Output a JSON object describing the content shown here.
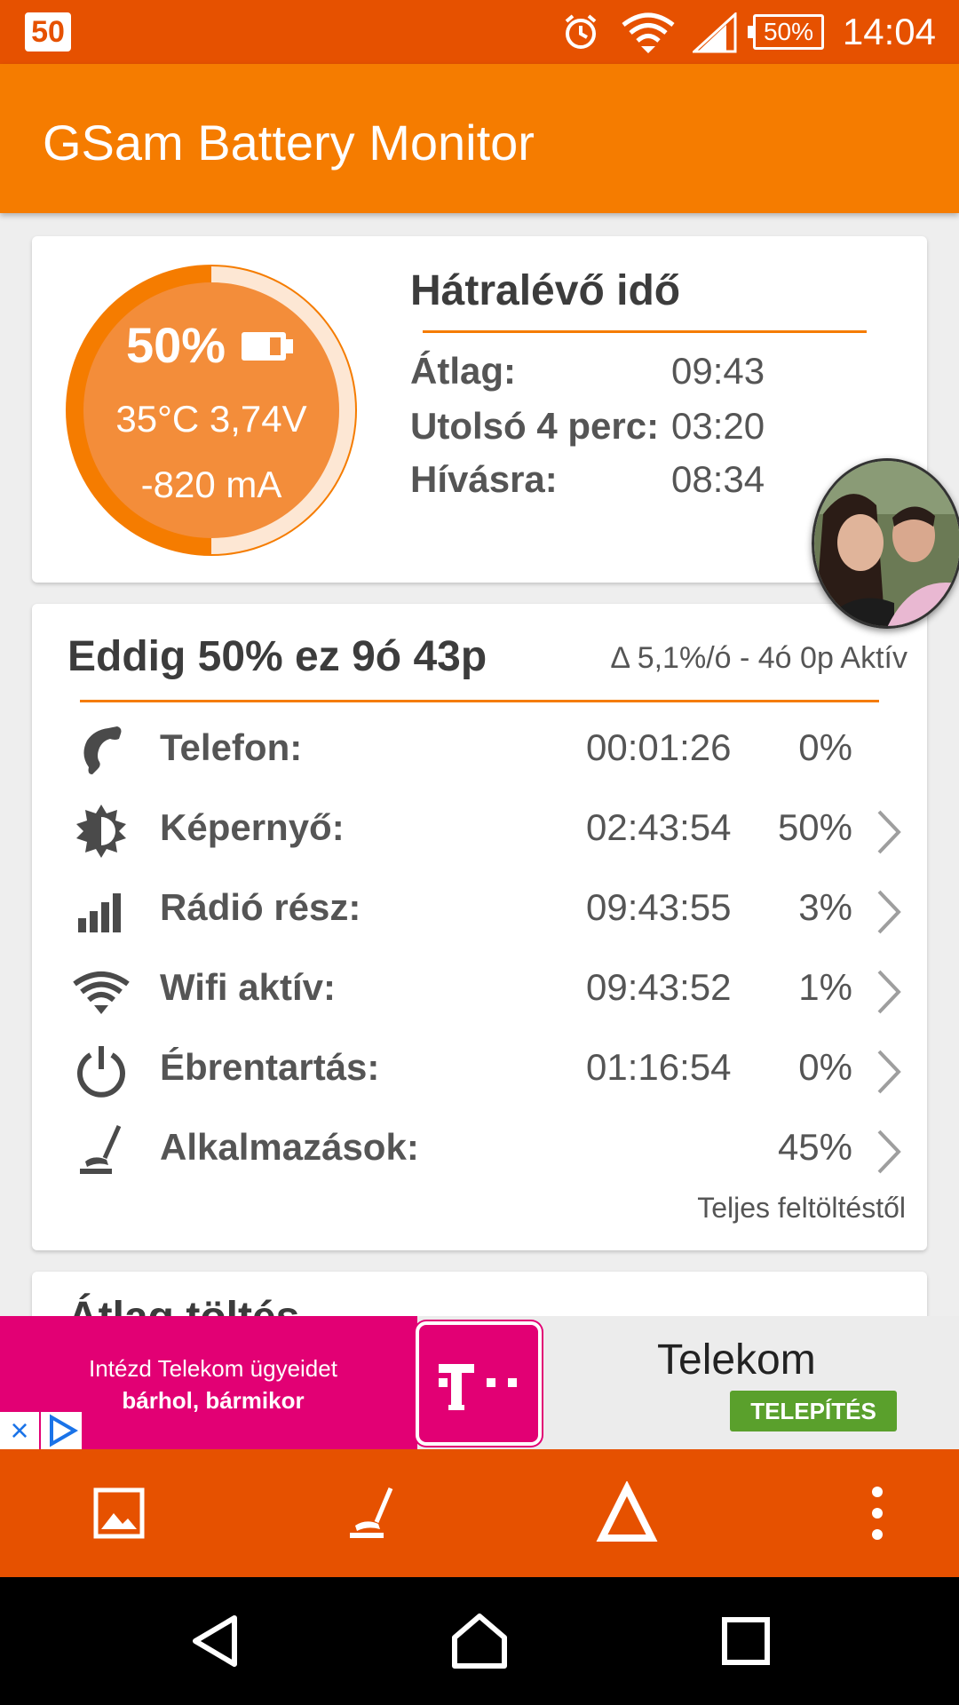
{
  "status_bar": {
    "badge": "50",
    "battery": "50%",
    "time": "14:04",
    "icons": [
      "alarm-icon",
      "wifi-icon",
      "signal-icon",
      "battery-icon"
    ]
  },
  "app": {
    "title": "GSam Battery Monitor",
    "accent": "#f57c00",
    "dark_accent": "#e65100"
  },
  "gauge": {
    "percent_label": "50%",
    "level": 0.5,
    "temperature": "35°C",
    "voltage": "3,74V",
    "temp_volt": "35°C  3,74V",
    "current": "-820 mA"
  },
  "remaining": {
    "title": "Hátralévő idő",
    "rows": [
      {
        "label": "Átlag:",
        "value": "09:43"
      },
      {
        "label": "Utolsó 4 perc:",
        "value": "03:20"
      },
      {
        "label": "Hívásra:",
        "value": "08:34"
      }
    ]
  },
  "usage": {
    "title": "Eddig 50% ez 9ó 43p",
    "rate": "Δ 5,1%/ó - 4ó 0p Aktív",
    "rows": [
      {
        "icon": "phone-icon",
        "label": "Telefon:",
        "time": "00:01:26",
        "pct": "0%",
        "chevron": false
      },
      {
        "icon": "screen-brightness-icon",
        "label": "Képernyő:",
        "time": "02:43:54",
        "pct": "50%",
        "chevron": true
      },
      {
        "icon": "signal-bars-icon",
        "label": "Rádió rész:",
        "time": "09:43:55",
        "pct": "3%",
        "chevron": true
      },
      {
        "icon": "wifi-icon",
        "label": "Wifi aktív:",
        "time": "09:43:52",
        "pct": "1%",
        "chevron": true
      },
      {
        "icon": "power-icon",
        "label": "Ébrentartás:",
        "time": "01:16:54",
        "pct": "0%",
        "chevron": true
      },
      {
        "icon": "apps-broom-icon",
        "label": "Alkalmazások:",
        "time": "",
        "pct": "45%",
        "chevron": true
      }
    ],
    "footer": "Teljes feltöltéstől"
  },
  "next_card": {
    "title": "Átlag töltés"
  },
  "ad": {
    "line1": "Intézd Telekom ügyeidet",
    "line2": "bárhol, bármikor",
    "brand": "Telekom",
    "cta": "TELEPÍTÉS",
    "logo_text": "T · ·",
    "pink": "#e20074",
    "cta_color": "#5aa02c"
  },
  "toolbar": {
    "icons": [
      "image-icon",
      "broom-icon",
      "warning-triangle-icon",
      "more-vert-icon"
    ]
  },
  "navbar": {
    "icons": [
      "back-icon",
      "home-icon",
      "recents-icon"
    ]
  }
}
